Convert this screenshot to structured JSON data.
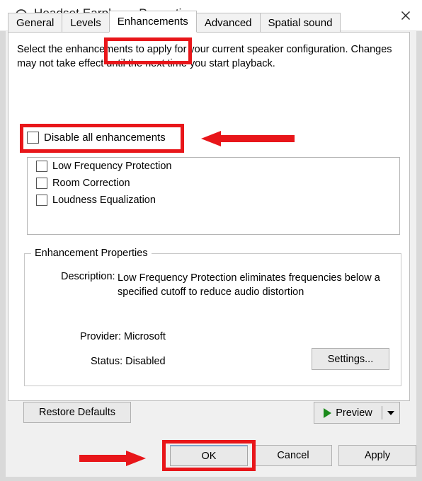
{
  "window": {
    "title": "Headset Earphone Properties",
    "icon": "headset-icon",
    "close_label": "×"
  },
  "tabs": [
    {
      "label": "General",
      "active": false
    },
    {
      "label": "Levels",
      "active": false
    },
    {
      "label": "Enhancements",
      "active": true
    },
    {
      "label": "Advanced",
      "active": false
    },
    {
      "label": "Spatial sound",
      "active": false
    }
  ],
  "content": {
    "intro": "Select the enhancements to apply for your current speaker configuration. Changes may not take effect until the next time you start playback.",
    "disable_all": {
      "label": "Disable all enhancements",
      "checked": false
    },
    "enhancements": [
      {
        "label": "Low Frequency Protection",
        "checked": false
      },
      {
        "label": "Room Correction",
        "checked": false
      },
      {
        "label": "Loudness Equalization",
        "checked": false
      }
    ]
  },
  "properties": {
    "group_title": "Enhancement Properties",
    "description_label": "Description:",
    "description_text": "Low Frequency Protection eliminates frequencies below a specified cutoff to reduce audio distortion",
    "provider": "Provider: Microsoft",
    "status": "Status: Disabled",
    "settings_button": "Settings..."
  },
  "footer": {
    "restore_defaults": "Restore Defaults",
    "preview": "Preview",
    "preview_icon": "play-icon",
    "preview_dropdown_icon": "chevron-down-icon",
    "ok": "OK",
    "cancel": "Cancel",
    "apply": "Apply"
  },
  "annotations": {
    "highlight_color": "#e8161a",
    "items": [
      {
        "name": "enhancements-tab-highlight",
        "shape": "rectangle"
      },
      {
        "name": "disable-all-highlight",
        "shape": "rectangle"
      },
      {
        "name": "disable-all-arrow",
        "shape": "arrow-left"
      },
      {
        "name": "ok-button-highlight",
        "shape": "rectangle"
      },
      {
        "name": "ok-button-arrow",
        "shape": "arrow-right"
      }
    ]
  }
}
